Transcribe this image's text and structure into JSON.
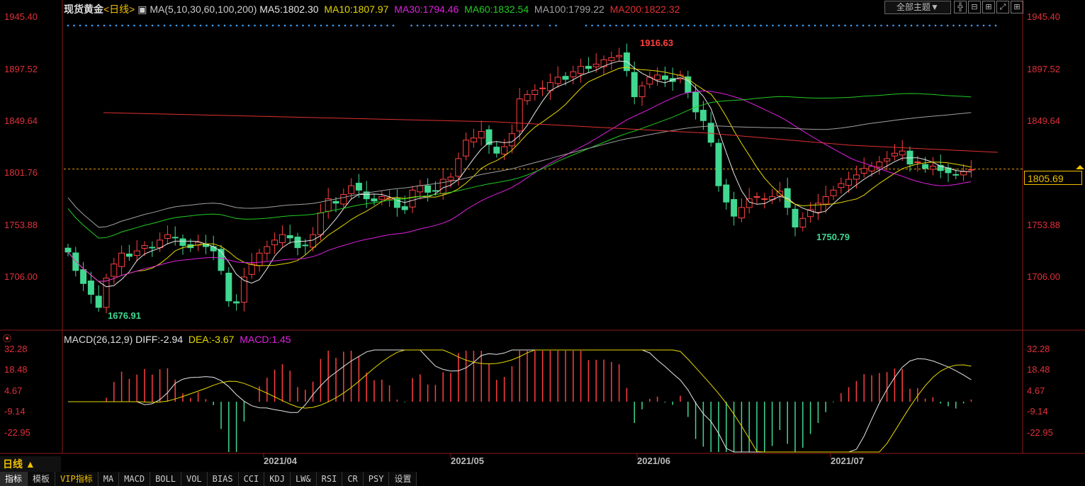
{
  "header": {
    "symbol": "现货黄金",
    "period": "<日线>",
    "ma_params": "MA(5,10,30,60,100,200)",
    "ma5": "MA5:1802.30",
    "ma10": "MA10:1807.97",
    "ma30": "MA30:1794.46",
    "ma60": "MA60:1832.54",
    "ma100": "MA100:1799.22",
    "ma200": "MA200:1822.32",
    "theme_button": "全部主题▼"
  },
  "colors": {
    "ma5": "#e6e6e6",
    "ma10": "#e6d800",
    "ma30": "#e020e0",
    "ma60": "#22cc22",
    "ma100": "#a0a0a0",
    "ma200": "#e03030",
    "up": "#ff4040",
    "down": "#40d890",
    "axis": "#e0303a"
  },
  "price_axis": {
    "ticks": [
      "1945.40",
      "1897.52",
      "1849.64",
      "1801.76",
      "1753.88",
      "1706.00"
    ],
    "current_price": "1805.69",
    "high_label": "1916.63",
    "low_label_1": "1676.91",
    "low_label_2": "1750.79"
  },
  "macd": {
    "title": "MACD(26,12,9)",
    "diff": "DIFF:-2.94",
    "dea": "DEA:-3.67",
    "value": "MACD:1.45",
    "ticks": [
      "32.28",
      "18.48",
      "4.67",
      "-9.14",
      "-22.95"
    ]
  },
  "dates": [
    "2021/04",
    "2021/05",
    "2021/06",
    "2021/07"
  ],
  "period_selector": "日线 ▲",
  "tabs": [
    "指标",
    "模板",
    "VIP指标",
    "MA",
    "MACD",
    "BOLL",
    "VOL",
    "BIAS",
    "CCI",
    "KDJ",
    "LW&",
    "RSI",
    "CR",
    "PSY",
    "设置"
  ],
  "chart_data": {
    "type": "candlestick",
    "x_labels": [
      "2021/04",
      "2021/05",
      "2021/06",
      "2021/07"
    ],
    "ylim": [
      1676.91,
      1945.4
    ],
    "close_series": [
      1729,
      1712,
      1700,
      1690,
      1678,
      1705,
      1718,
      1728,
      1725,
      1730,
      1735,
      1733,
      1740,
      1745,
      1742,
      1735,
      1733,
      1738,
      1734,
      1730,
      1712,
      1684,
      1682,
      1706,
      1718,
      1728,
      1734,
      1740,
      1745,
      1742,
      1733,
      1735,
      1745,
      1765,
      1778,
      1774,
      1782,
      1790,
      1786,
      1778,
      1776,
      1780,
      1779,
      1770,
      1768,
      1786,
      1790,
      1784,
      1785,
      1796,
      1798,
      1815,
      1832,
      1834,
      1840,
      1828,
      1820,
      1826,
      1838,
      1870,
      1874,
      1878,
      1880,
      1885,
      1890,
      1888,
      1895,
      1900,
      1898,
      1902,
      1906,
      1908,
      1910,
      1896,
      1872,
      1882,
      1890,
      1892,
      1888,
      1886,
      1892,
      1876,
      1858,
      1850,
      1830,
      1790,
      1775,
      1762,
      1770,
      1778,
      1780,
      1778,
      1780,
      1785,
      1770,
      1752,
      1760,
      1768,
      1774,
      1780,
      1786,
      1792,
      1796,
      1800,
      1806,
      1808,
      1812,
      1815,
      1820,
      1822,
      1810,
      1812,
      1806,
      1808,
      1804,
      1802,
      1800,
      1803,
      1805
    ],
    "ma_values": {
      "MA5": 1802.3,
      "MA10": 1807.97,
      "MA30": 1794.46,
      "MA60": 1832.54,
      "MA100": 1799.22,
      "MA200": 1822.32
    }
  }
}
